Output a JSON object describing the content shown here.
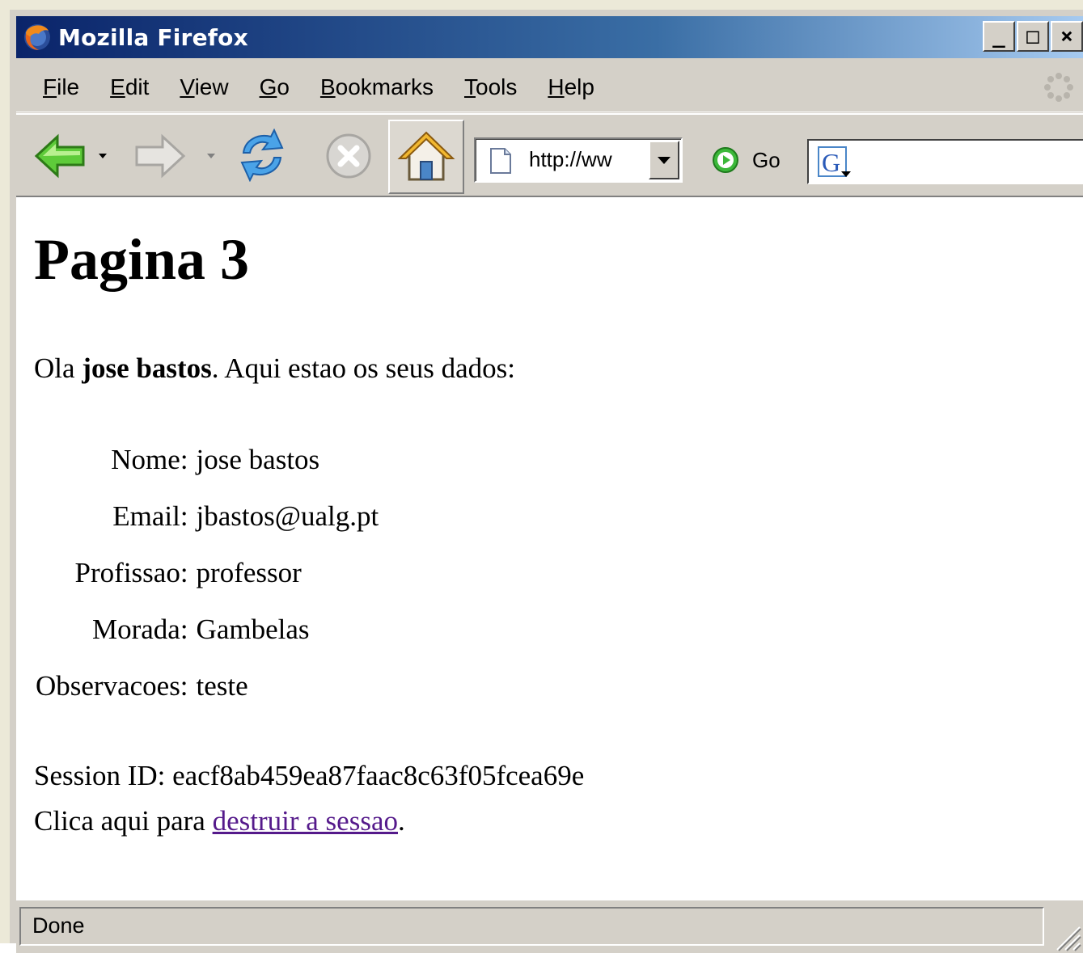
{
  "window": {
    "title": "Mozilla Firefox",
    "controls": [
      "_",
      "□",
      "×"
    ]
  },
  "menu": {
    "items": [
      {
        "label": "File",
        "accel": "F",
        "rest": "ile"
      },
      {
        "label": "Edit",
        "accel": "E",
        "rest": "dit"
      },
      {
        "label": "View",
        "accel": "V",
        "rest": "iew"
      },
      {
        "label": "Go",
        "accel": "G",
        "rest": "o"
      },
      {
        "label": "Bookmarks",
        "accel": "B",
        "rest": "ookmarks"
      },
      {
        "label": "Tools",
        "accel": "T",
        "rest": "ools"
      },
      {
        "label": "Help",
        "accel": "H",
        "rest": "elp"
      }
    ]
  },
  "toolbar": {
    "icons": [
      "back-arrow-icon",
      "forward-arrow-icon",
      "reload-icon",
      "stop-icon",
      "home-icon"
    ],
    "url": "http://ww",
    "go_label": "Go",
    "search_placeholder": ""
  },
  "page": {
    "heading": "Pagina 3",
    "greeting_prefix": "Ola ",
    "greeting_name": "jose bastos",
    "greeting_suffix": ". Aqui estao os seus dados:",
    "fields": [
      {
        "label": "Nome:",
        "value": "jose bastos"
      },
      {
        "label": "Email:",
        "value": "jbastos@ualg.pt"
      },
      {
        "label": "Profissao:",
        "value": "professor"
      },
      {
        "label": "Morada:",
        "value": "Gambelas"
      },
      {
        "label": "Observacoes:",
        "value": "teste"
      }
    ],
    "session_label": "Session ID: ",
    "session_id": "eacf8ab459ea87faac8c63f05fcea69e",
    "destroy_prefix": "Clica aqui para ",
    "destroy_link": "destruir a sessao",
    "destroy_suffix": "."
  },
  "status": {
    "text": "Done"
  },
  "colors": {
    "titlebar_start": "#0a246a",
    "link_visited": "#551a8b"
  }
}
